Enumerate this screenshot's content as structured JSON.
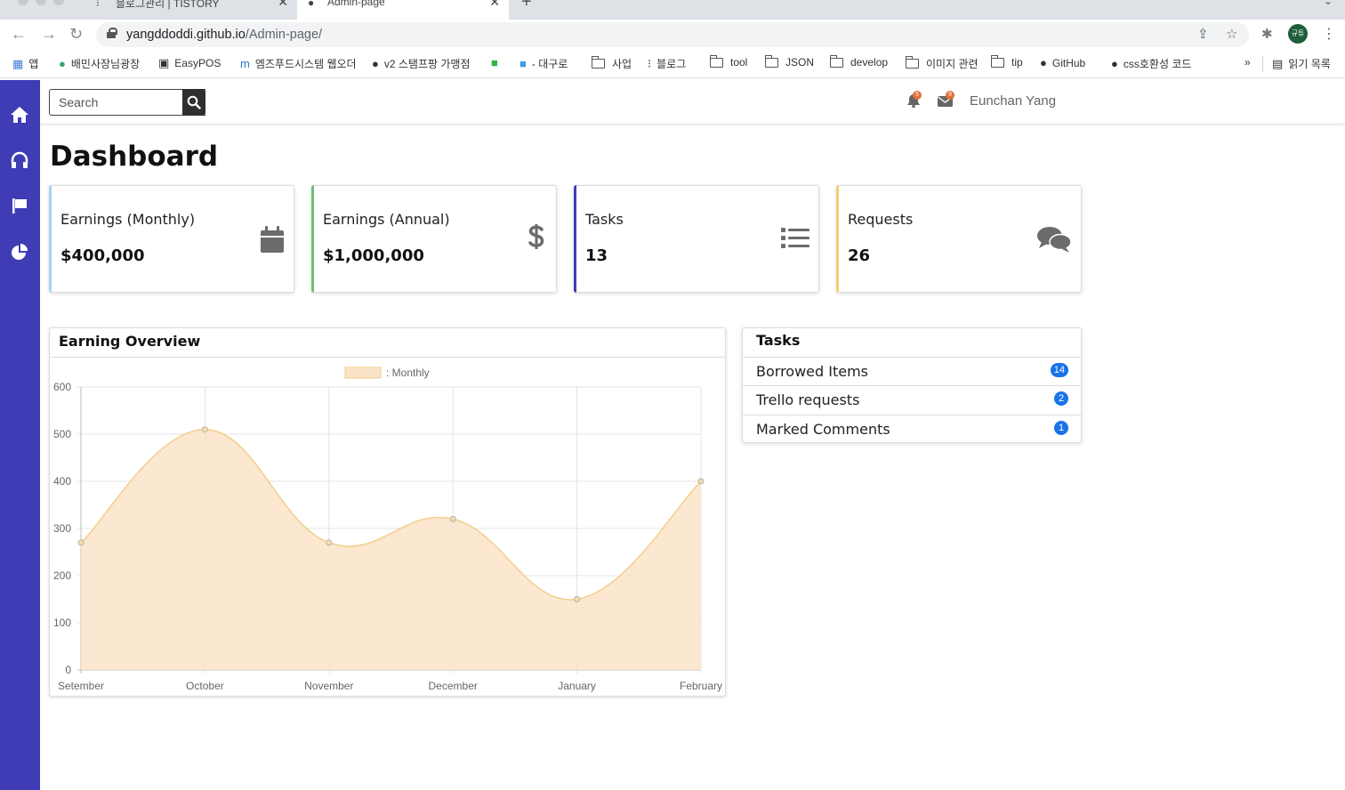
{
  "browser": {
    "tabs": [
      {
        "title": "블로그관리 | TISTORY",
        "active": false
      },
      {
        "title": "Admin-page",
        "active": true
      }
    ],
    "url_host": "yangddoddi.github.io",
    "url_path": "/Admin-page/",
    "profile_label": "규튜",
    "bookmarks": [
      "앱",
      "배민사장님광장",
      "EasyPOS",
      "엠즈푸드시스템 웹오더",
      "v2 스탬프팡 가맹점",
      "- 대구로",
      "사업",
      "블로그",
      "tool",
      "JSON",
      "develop",
      "이미지 관련",
      "tip",
      "GitHub",
      "css호환성 코드"
    ],
    "bookmarks_more": "»",
    "reading_list": "읽기 목록"
  },
  "sidebar": {
    "items": [
      {
        "icon": "home-icon"
      },
      {
        "icon": "headphones-icon"
      },
      {
        "icon": "flag-icon"
      },
      {
        "icon": "pie-chart-icon"
      }
    ],
    "color": "#3f3cb6"
  },
  "topbar": {
    "search_placeholder": "Search",
    "notifications_count": "5",
    "messages_count": "9",
    "user_name": "Eunchan Yang"
  },
  "page": {
    "title": "Dashboard"
  },
  "cards": [
    {
      "label": "Earnings (Monthly)",
      "value": "$400,000",
      "icon": "calendar-icon",
      "accent": "#a8d4f0"
    },
    {
      "label": "Earnings (Annual)",
      "value": "$1,000,000",
      "icon": "dollar-icon",
      "accent": "#6cc070"
    },
    {
      "label": "Tasks",
      "value": "13",
      "icon": "list-icon",
      "accent": "#3f3cb6"
    },
    {
      "label": "Requests",
      "value": "26",
      "icon": "comments-icon",
      "accent": "#f0cf73"
    }
  ],
  "earning_overview": {
    "title": "Earning Overview"
  },
  "chart_data": {
    "type": "area",
    "categories": [
      "Setember",
      "October",
      "November",
      "December",
      "January",
      "February"
    ],
    "series": [
      {
        "name": "Monthly",
        "values": [
          270,
          510,
          270,
          320,
          150,
          400
        ]
      }
    ],
    "legend_text": ": Monthly",
    "legend_position": "top",
    "ylim": [
      0,
      600
    ],
    "yticks": [
      "600",
      "500",
      "400",
      "300",
      "200",
      "100",
      "0"
    ],
    "grid": true,
    "fill_color": "#fbe3c8",
    "line_color": "#f3cf8a"
  },
  "tasks_panel": {
    "title": "Tasks",
    "items": [
      {
        "label": "Borrowed Items",
        "count": "14"
      },
      {
        "label": "Trello requests",
        "count": "2"
      },
      {
        "label": "Marked Comments",
        "count": "1"
      }
    ]
  }
}
